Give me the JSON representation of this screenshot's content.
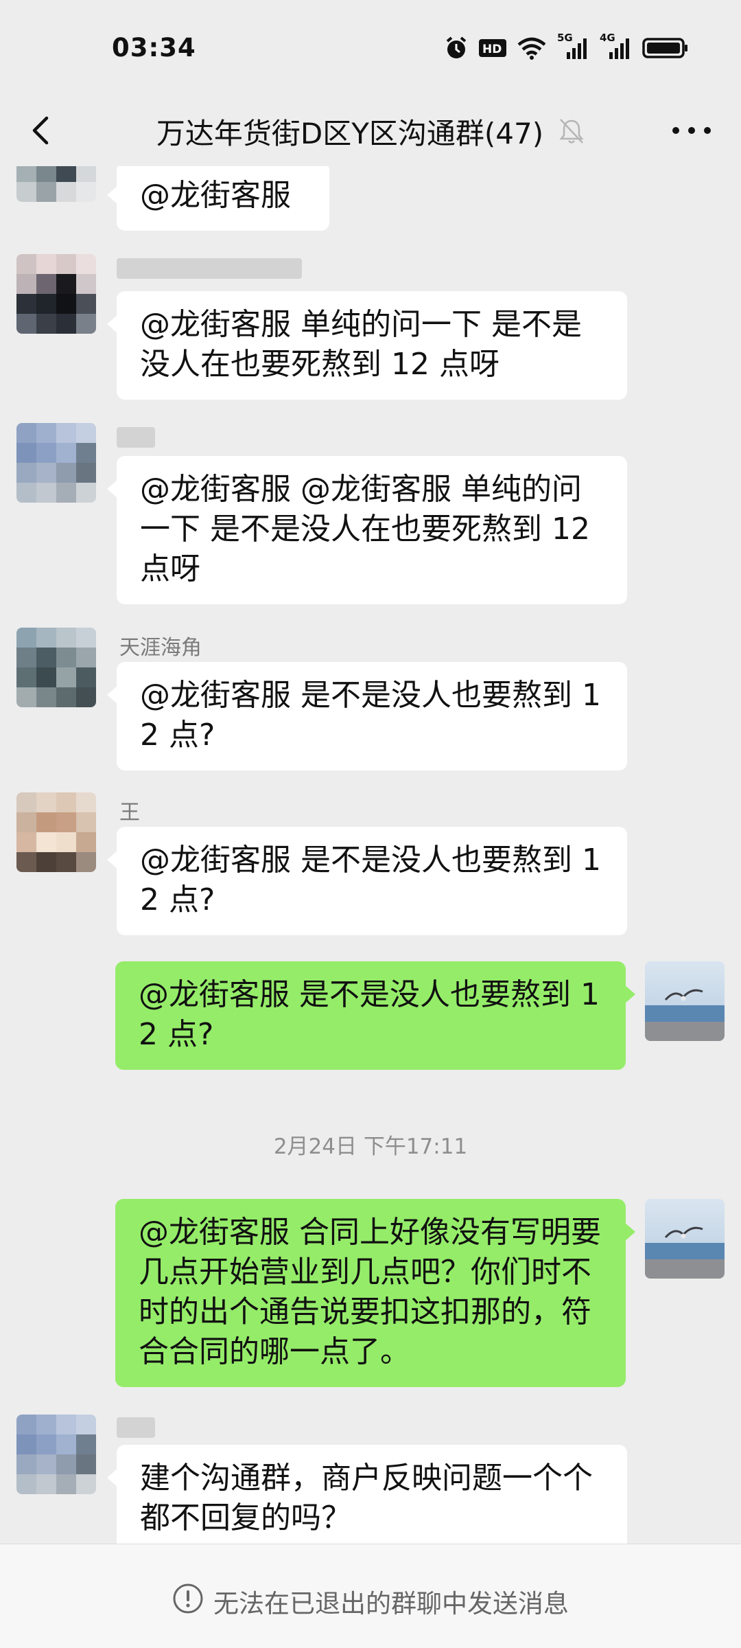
{
  "status_bar": {
    "time": "03:34",
    "icons": [
      "alarm-icon",
      "hd-icon",
      "wifi-icon",
      "signal-5g-icon",
      "signal-4g-icon",
      "battery-icon"
    ],
    "net1": "5G",
    "net2": "4G"
  },
  "nav": {
    "title": "万达年货街D区Y区沟通群(47)",
    "icons": [
      "back-icon",
      "mute-bell-icon",
      "more-icon"
    ]
  },
  "messages": [
    {
      "sender": "",
      "text": "@龙街客服",
      "mine": false
    },
    {
      "sender": "",
      "text": "@龙街客服  单纯的问一下 是不是没人在也要死熬到 12 点呀",
      "mine": false
    },
    {
      "sender": "",
      "text": "@龙街客服 @龙街客服  单纯的问一下 是不是没人在也要死熬到 12 点呀",
      "mine": false
    },
    {
      "sender": "天涯海角",
      "text": "@龙街客服  是不是没人也要熬到 12 点?",
      "mine": false
    },
    {
      "sender": "王",
      "text": "@龙街客服  是不是没人也要熬到 12 点?",
      "mine": false
    },
    {
      "sender": "",
      "text": "@龙街客服  是不是没人也要熬到 12 点?",
      "mine": true
    },
    {
      "sender": "",
      "text": "@龙街客服  合同上好像没有写明要几点开始营业到几点吧？你们时不时的出个通告说要扣这扣那的，符合合同的哪一点了。",
      "mine": true
    },
    {
      "sender": "",
      "text": "建个沟通群，商户反映问题一个个都不回复的吗？",
      "mine": false
    }
  ],
  "timestamp": "2月24日 下午17:11",
  "bottom": {
    "notice": "无法在已退出的群聊中发送消息",
    "icon": "exclamation-circle-icon"
  },
  "colors": {
    "background": "#ededed",
    "mine_bubble": "#95ec69",
    "other_bubble": "#ffffff",
    "meta_text": "#8e8e8e"
  }
}
